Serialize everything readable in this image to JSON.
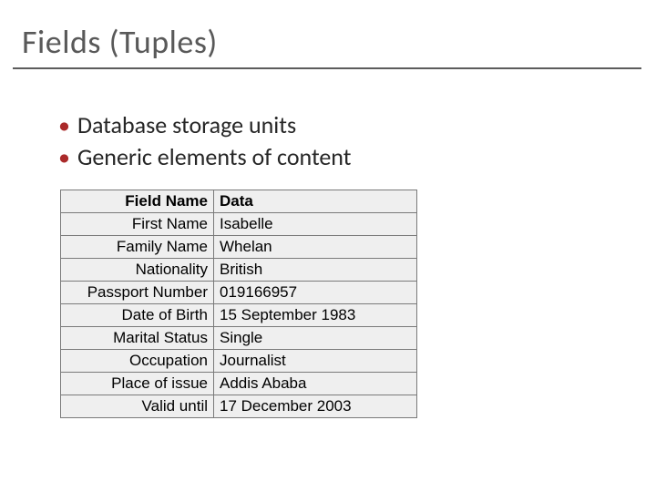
{
  "title": "Fields (Tuples)",
  "bullets": [
    "Database storage units",
    "Generic elements of content"
  ],
  "table": {
    "header": {
      "label": "Field Name",
      "data": "Data"
    },
    "rows": [
      {
        "label": "First Name",
        "data": "Isabelle"
      },
      {
        "label": "Family Name",
        "data": "Whelan"
      },
      {
        "label": "Nationality",
        "data": "British"
      },
      {
        "label": "Passport Number",
        "data": "019166957"
      },
      {
        "label": "Date of Birth",
        "data": "15 September 1983"
      },
      {
        "label": "Marital Status",
        "data": "Single"
      },
      {
        "label": "Occupation",
        "data": "Journalist"
      },
      {
        "label": "Place of issue",
        "data": "Addis Ababa"
      },
      {
        "label": "Valid until",
        "data": "17 December 2003"
      }
    ]
  }
}
